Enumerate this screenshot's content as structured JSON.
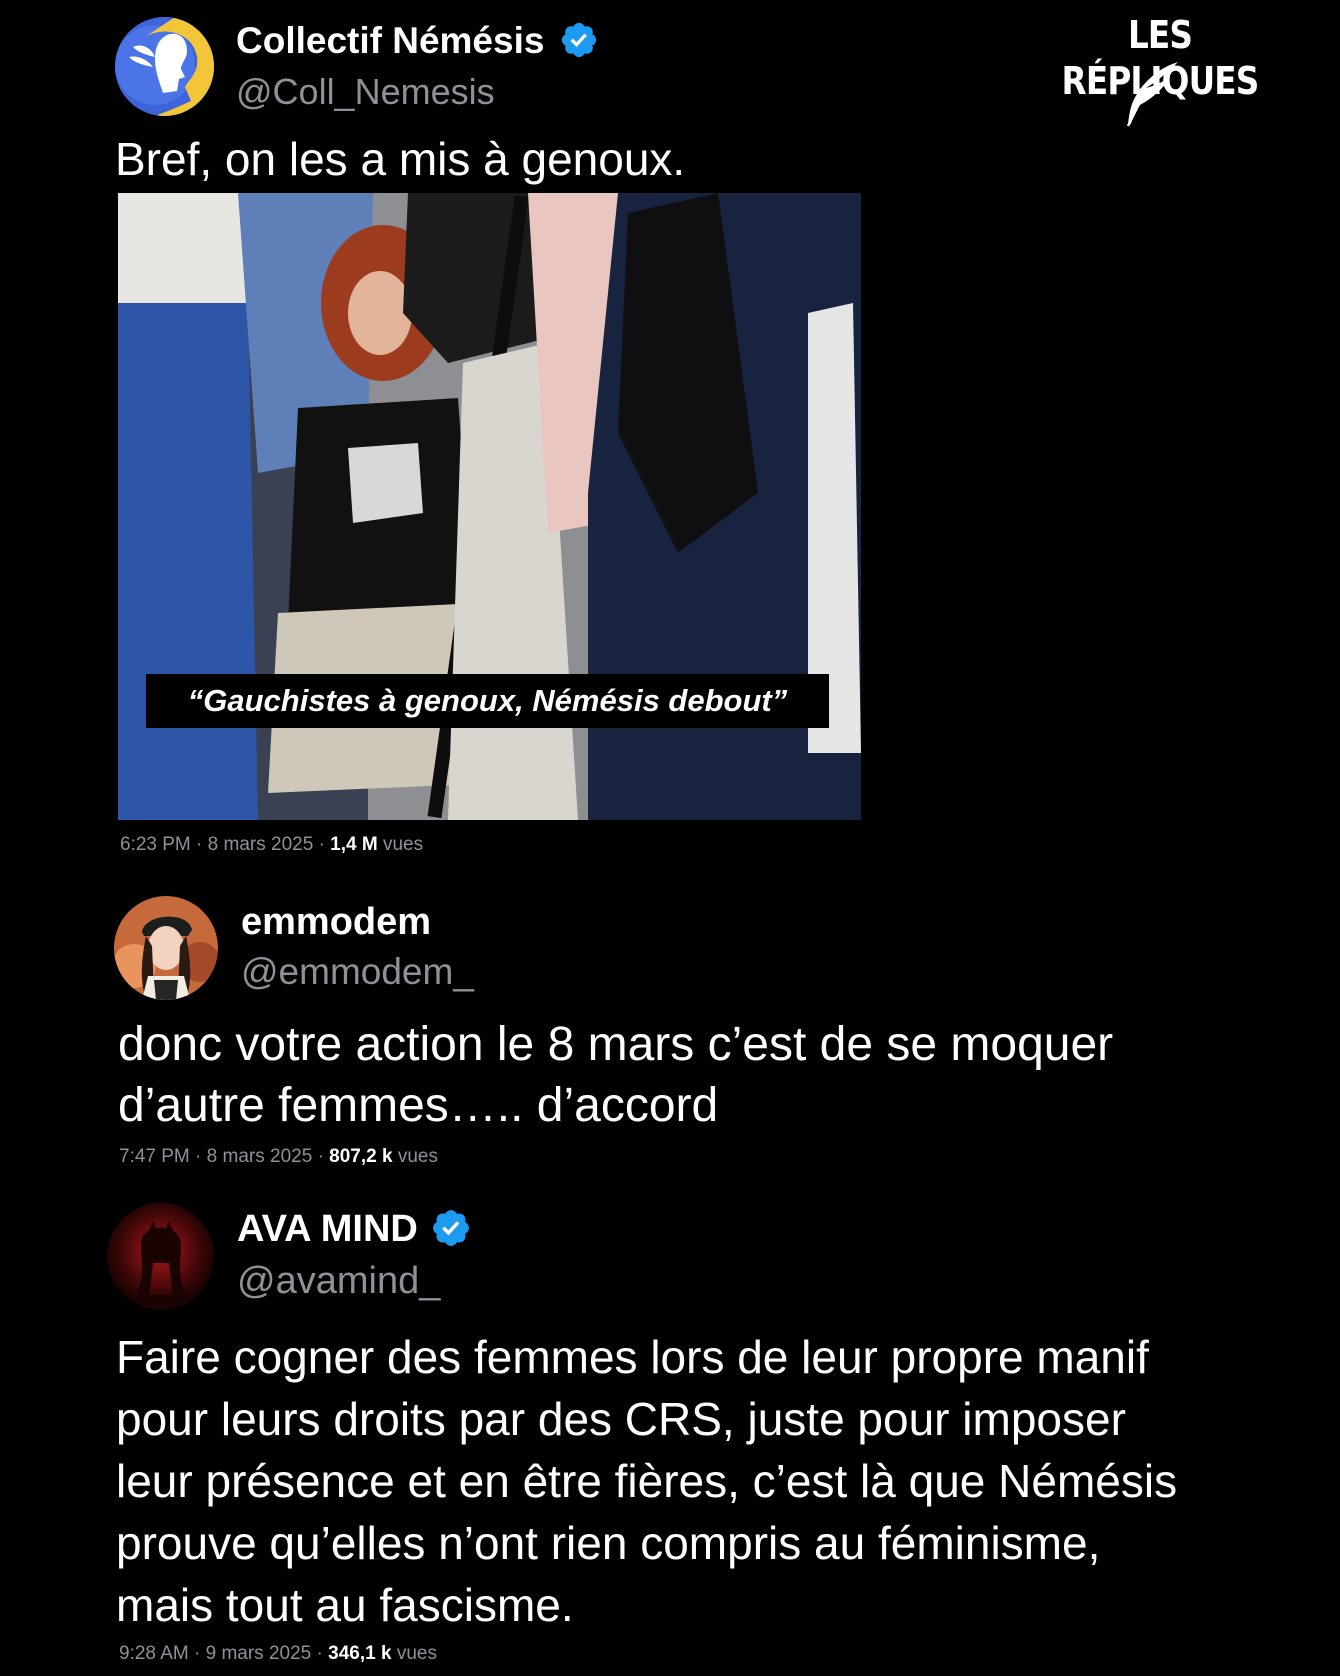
{
  "brand": {
    "name": "LES RÉPLIQUES"
  },
  "tweets": [
    {
      "name": "Collectif Némésis",
      "handle": "@Coll_Nemesis",
      "verified": true,
      "text": "Bref, on les a mis à genoux.",
      "media_caption": "“Gauchistes à genoux, Némésis debout”",
      "time": "6:23 PM",
      "date": "8 mars 2025",
      "views_count": "1,4 M",
      "views_label": "vues"
    },
    {
      "name": "emmodem",
      "handle": "@emmodem_",
      "verified": false,
      "text_lines": [
        "donc votre action le 8 mars c’est de se moquer",
        "d’autre femmes….. d’accord"
      ],
      "time": "7:47 PM",
      "date": "8 mars 2025",
      "views_count": "807,2 k",
      "views_label": "vues"
    },
    {
      "name": "AVA MIND",
      "handle": "@avamind_",
      "verified": true,
      "text_lines": [
        "Faire cogner des femmes lors de leur propre manif",
        "pour leurs droits par des CRS, juste pour imposer",
        "leur présence et en être fières, c’est là que Némésis",
        "prouve qu’elles n’ont rien compris au féminisme,",
        "mais tout au fascisme."
      ],
      "time": "9:28 AM",
      "date": "9 mars 2025",
      "views_count": "346,1 k",
      "views_label": "vues"
    }
  ],
  "meta_separator": "·",
  "colors": {
    "background": "#000000",
    "text": "#ffffff",
    "secondary_text": "#8e9196",
    "verified_badge": "#1d9bf0"
  },
  "icons": {
    "verified": "verified-badge-icon",
    "brand_quill": "quill-icon"
  }
}
